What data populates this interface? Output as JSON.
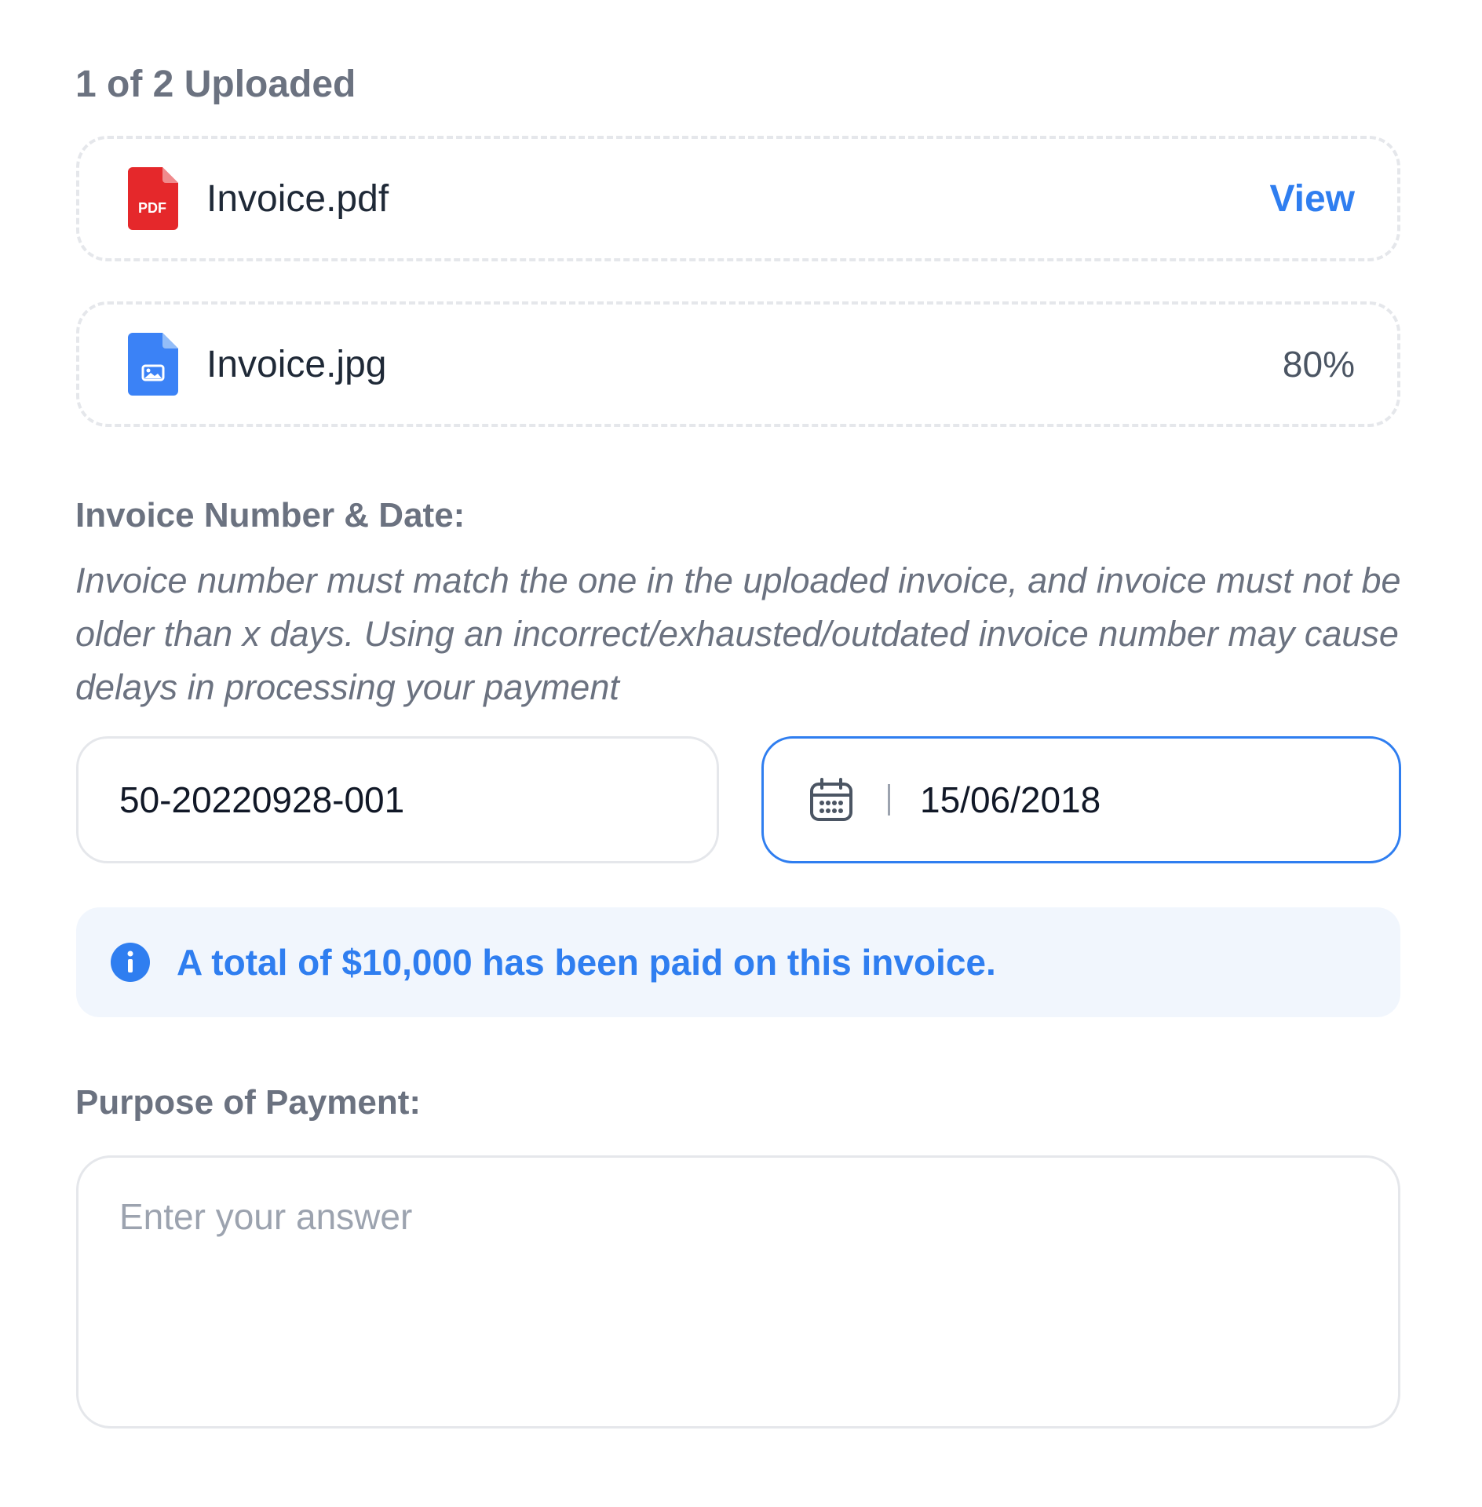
{
  "upload": {
    "status": "1 of 2 Uploaded",
    "files": [
      {
        "name": "Invoice.pdf",
        "icon": "pdf-file-icon",
        "icon_color": "#e5282b",
        "icon_label": "PDF",
        "action_label": "View"
      },
      {
        "name": "Invoice.jpg",
        "icon": "image-file-icon",
        "icon_color": "#3b82f6",
        "progress_text": "80%",
        "progress": 0.8
      }
    ]
  },
  "invoice": {
    "label": "Invoice Number & Date:",
    "helper": "Invoice number must match the one in the uploaded invoice, and invoice must not be older than x days. Using an incorrect/exhausted/outdated invoice number may cause delays in processing your payment",
    "number_value": "50-20220928-001",
    "date_icon": "calendar-icon",
    "date_value": "15/06/2018"
  },
  "info": {
    "icon": "info-icon",
    "text": "A total of $10,000 has been paid on this invoice."
  },
  "purpose": {
    "label": "Purpose of Payment:",
    "placeholder": "Enter your answer"
  },
  "colors": {
    "accent": "#2f7ef0",
    "pdf": "#e5282b",
    "image": "#3b82f6",
    "banner_bg": "#f1f6fd"
  }
}
